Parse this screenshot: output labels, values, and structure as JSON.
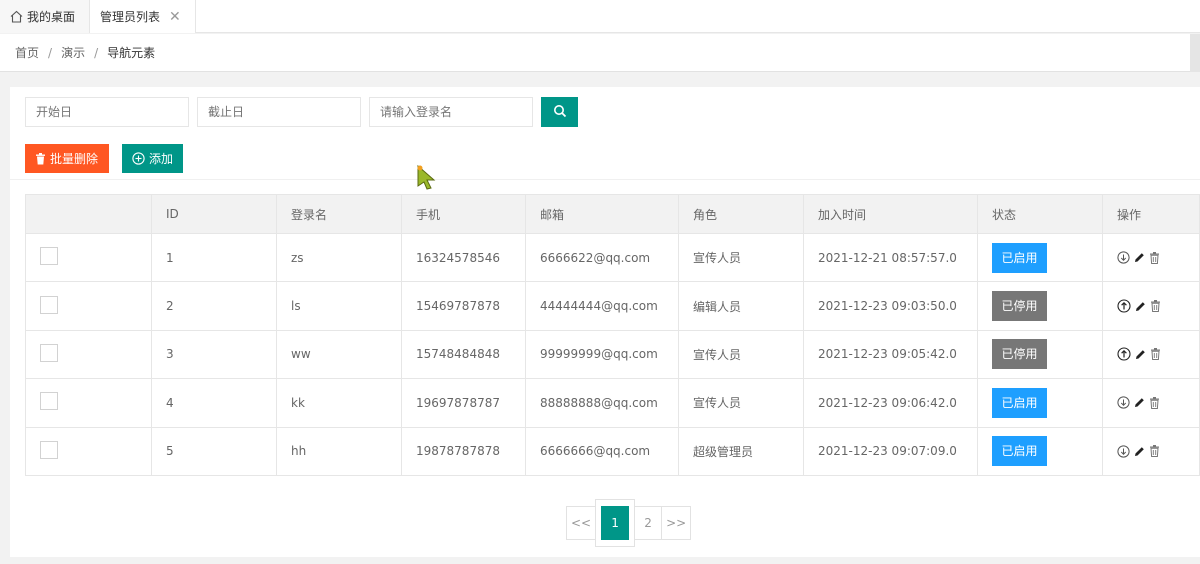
{
  "tabs": [
    {
      "label": "我的桌面",
      "icon": "home-icon"
    },
    {
      "label": "管理员列表",
      "icon": "close-icon",
      "close": "✕"
    }
  ],
  "breadcrumb": [
    "首页",
    "演示",
    "导航元素"
  ],
  "breadcrumb_sep": "/",
  "search": {
    "start_placeholder": "开始日",
    "end_placeholder": "截止日",
    "login_placeholder": "请输入登录名"
  },
  "toolbar": {
    "batch_delete_label": "批量删除",
    "add_label": "添加"
  },
  "table": {
    "headers": [
      "",
      "ID",
      "登录名",
      "手机",
      "邮箱",
      "角色",
      "加入时间",
      "状态",
      "操作"
    ],
    "rows": [
      {
        "id": "1",
        "login": "zs",
        "phone": "16324578546",
        "email": "6666622@qq.com",
        "role": "宣传人员",
        "joined": "2021-12-21 08:57:57.0",
        "status": "已启用",
        "enabled": true
      },
      {
        "id": "2",
        "login": "ls",
        "phone": "15469787878",
        "email": "44444444@qq.com",
        "role": "编辑人员",
        "joined": "2021-12-23 09:03:50.0",
        "status": "已停用",
        "enabled": false
      },
      {
        "id": "3",
        "login": "ww",
        "phone": "15748484848",
        "email": "99999999@qq.com",
        "role": "宣传人员",
        "joined": "2021-12-23 09:05:42.0",
        "status": "已停用",
        "enabled": false
      },
      {
        "id": "4",
        "login": "kk",
        "phone": "19697878787",
        "email": "88888888@qq.com",
        "role": "宣传人员",
        "joined": "2021-12-23 09:06:42.0",
        "status": "已启用",
        "enabled": true
      },
      {
        "id": "5",
        "login": "hh",
        "phone": "19878787878",
        "email": "6666666@qq.com",
        "role": "超级管理员",
        "joined": "2021-12-23 09:07:09.0",
        "status": "已启用",
        "enabled": true
      }
    ]
  },
  "pagination": {
    "prev": "<<",
    "current": "1",
    "next_page": "2",
    "next": ">>"
  },
  "colors": {
    "primary": "#009688",
    "danger": "#ff5722",
    "enabled": "#1e9fff",
    "disabled": "#777777"
  }
}
